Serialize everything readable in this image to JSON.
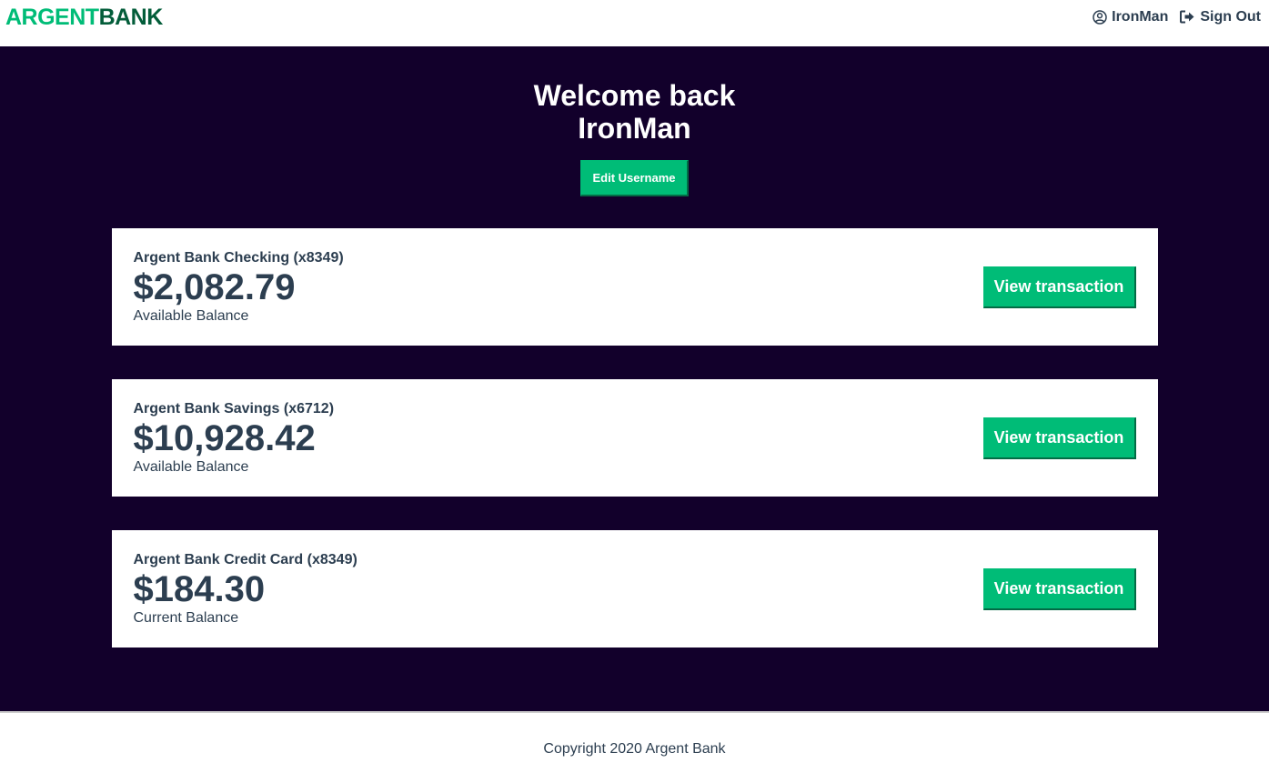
{
  "nav": {
    "logo_part1": "ARGENT",
    "logo_part2": "BANK",
    "user_name": "IronMan",
    "user_icon": "user-circle-icon",
    "sign_out_label": "Sign Out",
    "sign_out_icon": "sign-out-icon"
  },
  "header": {
    "line1": "Welcome back",
    "line2": "IronMan",
    "edit_button": "Edit Username"
  },
  "accounts": [
    {
      "title": "Argent Bank Checking (x8349)",
      "amount": "$2,082.79",
      "description": "Available Balance",
      "button": "View transaction"
    },
    {
      "title": "Argent Bank Savings (x6712)",
      "amount": "$10,928.42",
      "description": "Available Balance",
      "button": "View transaction"
    },
    {
      "title": "Argent Bank Credit Card (x8349)",
      "amount": "$184.30",
      "description": "Current Balance",
      "button": "View transaction"
    }
  ],
  "footer": {
    "copyright": "Copyright 2020 Argent Bank"
  },
  "colors": {
    "accent": "#00bc77",
    "accent_dark": "#035d3a",
    "background_dark": "#12002b",
    "text": "#2c3e50"
  }
}
